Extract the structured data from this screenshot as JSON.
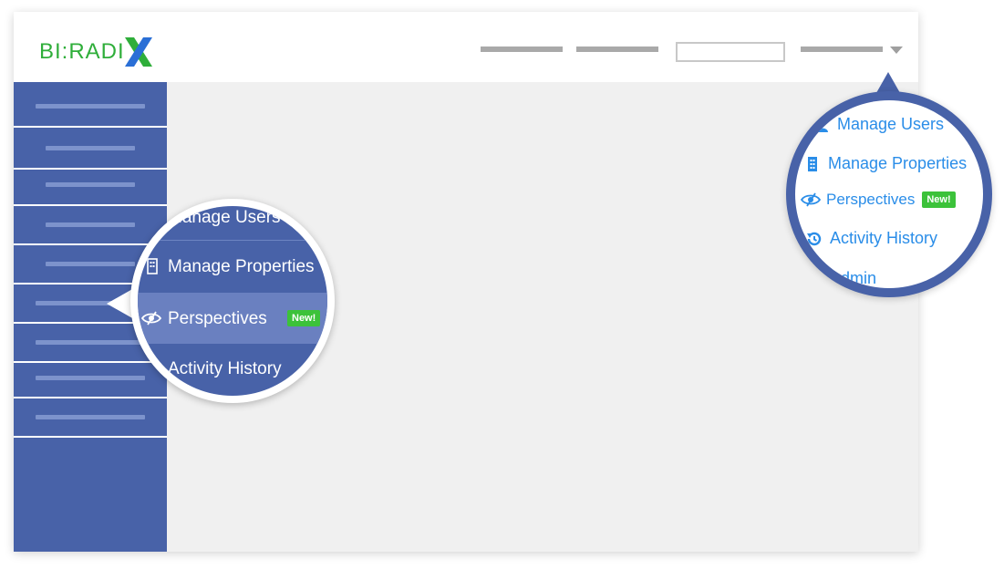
{
  "brand": {
    "logo_text": "BI:RADI",
    "logo_mark": "X"
  },
  "left_magnifier": {
    "items": [
      {
        "label": "Manage Users",
        "icon": "user-icon"
      },
      {
        "label": "Manage Properties",
        "icon": "building-icon"
      },
      {
        "label": "Perspectives",
        "icon": "eye-icon",
        "badge": "New!"
      },
      {
        "label": "Activity History",
        "icon": "history-icon"
      }
    ]
  },
  "right_magnifier": {
    "items": [
      {
        "label": "Manage Users",
        "icon": "user-icon"
      },
      {
        "label": "Manage Properties",
        "icon": "building-icon"
      },
      {
        "label": "Perspectives",
        "icon": "eye-icon",
        "badge": "New!"
      },
      {
        "label": "Activity History",
        "icon": "history-icon"
      },
      {
        "label": "Admin",
        "icon": "admin-icon"
      }
    ]
  },
  "colors": {
    "sidebar": "#4862a8",
    "accent_green": "#3cc23a",
    "link_blue": "#2a8de8",
    "logo_green": "#2fae3a",
    "logo_blue": "#2a6fd6"
  }
}
